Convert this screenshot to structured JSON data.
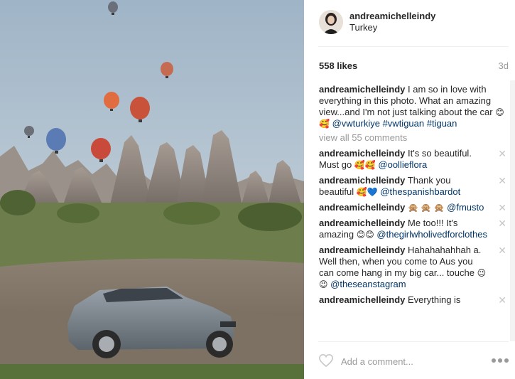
{
  "post": {
    "username": "andreamichelleindy",
    "location": "Turkey",
    "likes": "558 likes",
    "time": "3d"
  },
  "caption": {
    "username": "andreamichelleindy",
    "text": "I am so in love with everything in this photo. What an amazing view...and I'm not just talking about the car",
    "emojis": "😊🥰",
    "mention": "@vwturkiye",
    "hashtags": "#vwtiguan #tiguan"
  },
  "view_all": "view all 55 comments",
  "comments": [
    {
      "username": "andreamichelleindy",
      "text": "It's so beautiful. Must go",
      "emojis": "🥰🥰",
      "mention": "@oollieflora"
    },
    {
      "username": "andreamichelleindy",
      "text": "Thank you beautiful",
      "emojis": "🥰💙",
      "mention": "@thespanishbardot"
    },
    {
      "username": "andreamichelleindy",
      "text": "",
      "emojis": "🙊 🙊 🙊",
      "mention": "@fmusto"
    },
    {
      "username": "andreamichelleindy",
      "text": "Me too!!! It's amazing",
      "emojis": "😊😊",
      "mention": "@thegirlwholivedforclothes"
    },
    {
      "username": "andreamichelleindy",
      "text": "Hahahahahhah a. Well then, when you come to Aus you can come hang in my big car... touche",
      "emojis": "😉😉",
      "mention": "@theseanstagram"
    },
    {
      "username": "andreamichelleindy",
      "text": "Everything is",
      "emojis": "",
      "mention": ""
    }
  ],
  "add_comment": {
    "placeholder": "Add a comment..."
  },
  "icons": {
    "like": "heart-outline-icon",
    "more": "more-options-icon",
    "delete": "close-icon"
  },
  "colors": {
    "link": "#003569",
    "muted": "#999999",
    "border": "#efefef"
  }
}
